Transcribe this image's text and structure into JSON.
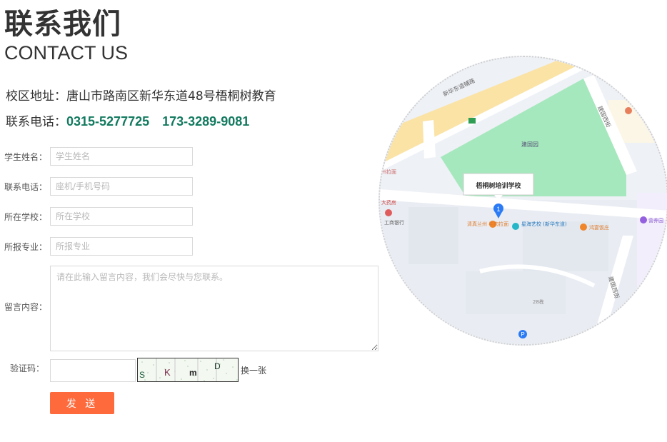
{
  "header": {
    "title_cn": "联系我们",
    "title_en": "CONTACT US"
  },
  "contact": {
    "address_label": "校区地址：",
    "address_value": "唐山市路南区新华东道48号梧桐树教育",
    "phone_label": "联系电话：",
    "phone_1": "0315-5277725",
    "phone_2": "173-3289-9081"
  },
  "form": {
    "name_label": "学生姓名：",
    "name_placeholder": "学生姓名",
    "phone_label": "联系电话：",
    "phone_placeholder": "座机/手机号码",
    "school_label": "所在学校：",
    "school_placeholder": "所在学校",
    "major_label": "所报专业：",
    "major_placeholder": "所报专业",
    "message_label": "留言内容：",
    "message_placeholder": "请在此输入留言内容，我们会尽快与您联系。",
    "captcha_label": "验证码：",
    "captcha_text": "SKmD",
    "captcha_refresh": "换一张",
    "send_label": "发 送"
  },
  "map": {
    "callout": "梧桐树培训学校",
    "marker_number": "1",
    "labels": {
      "road_north": "新华东道辅路",
      "park": "建国园",
      "road_east": "建国西街",
      "road_south": "建国西街",
      "shop_1": "清真兰州\n牛肉拉面",
      "shop_2": "星海艺校\n(新华东道)",
      "shop_3": "鸿宴饭庄",
      "bank": "工商银行",
      "pharmacy": "大药房",
      "noodle_left": "州拉面",
      "store_right": "营养园",
      "building_no": "28栋"
    },
    "colors": {
      "park": "#a6e8bd",
      "road_main": "#fbe3a5",
      "block": "#e4e8ef",
      "marker": "#2b7bf6"
    }
  }
}
